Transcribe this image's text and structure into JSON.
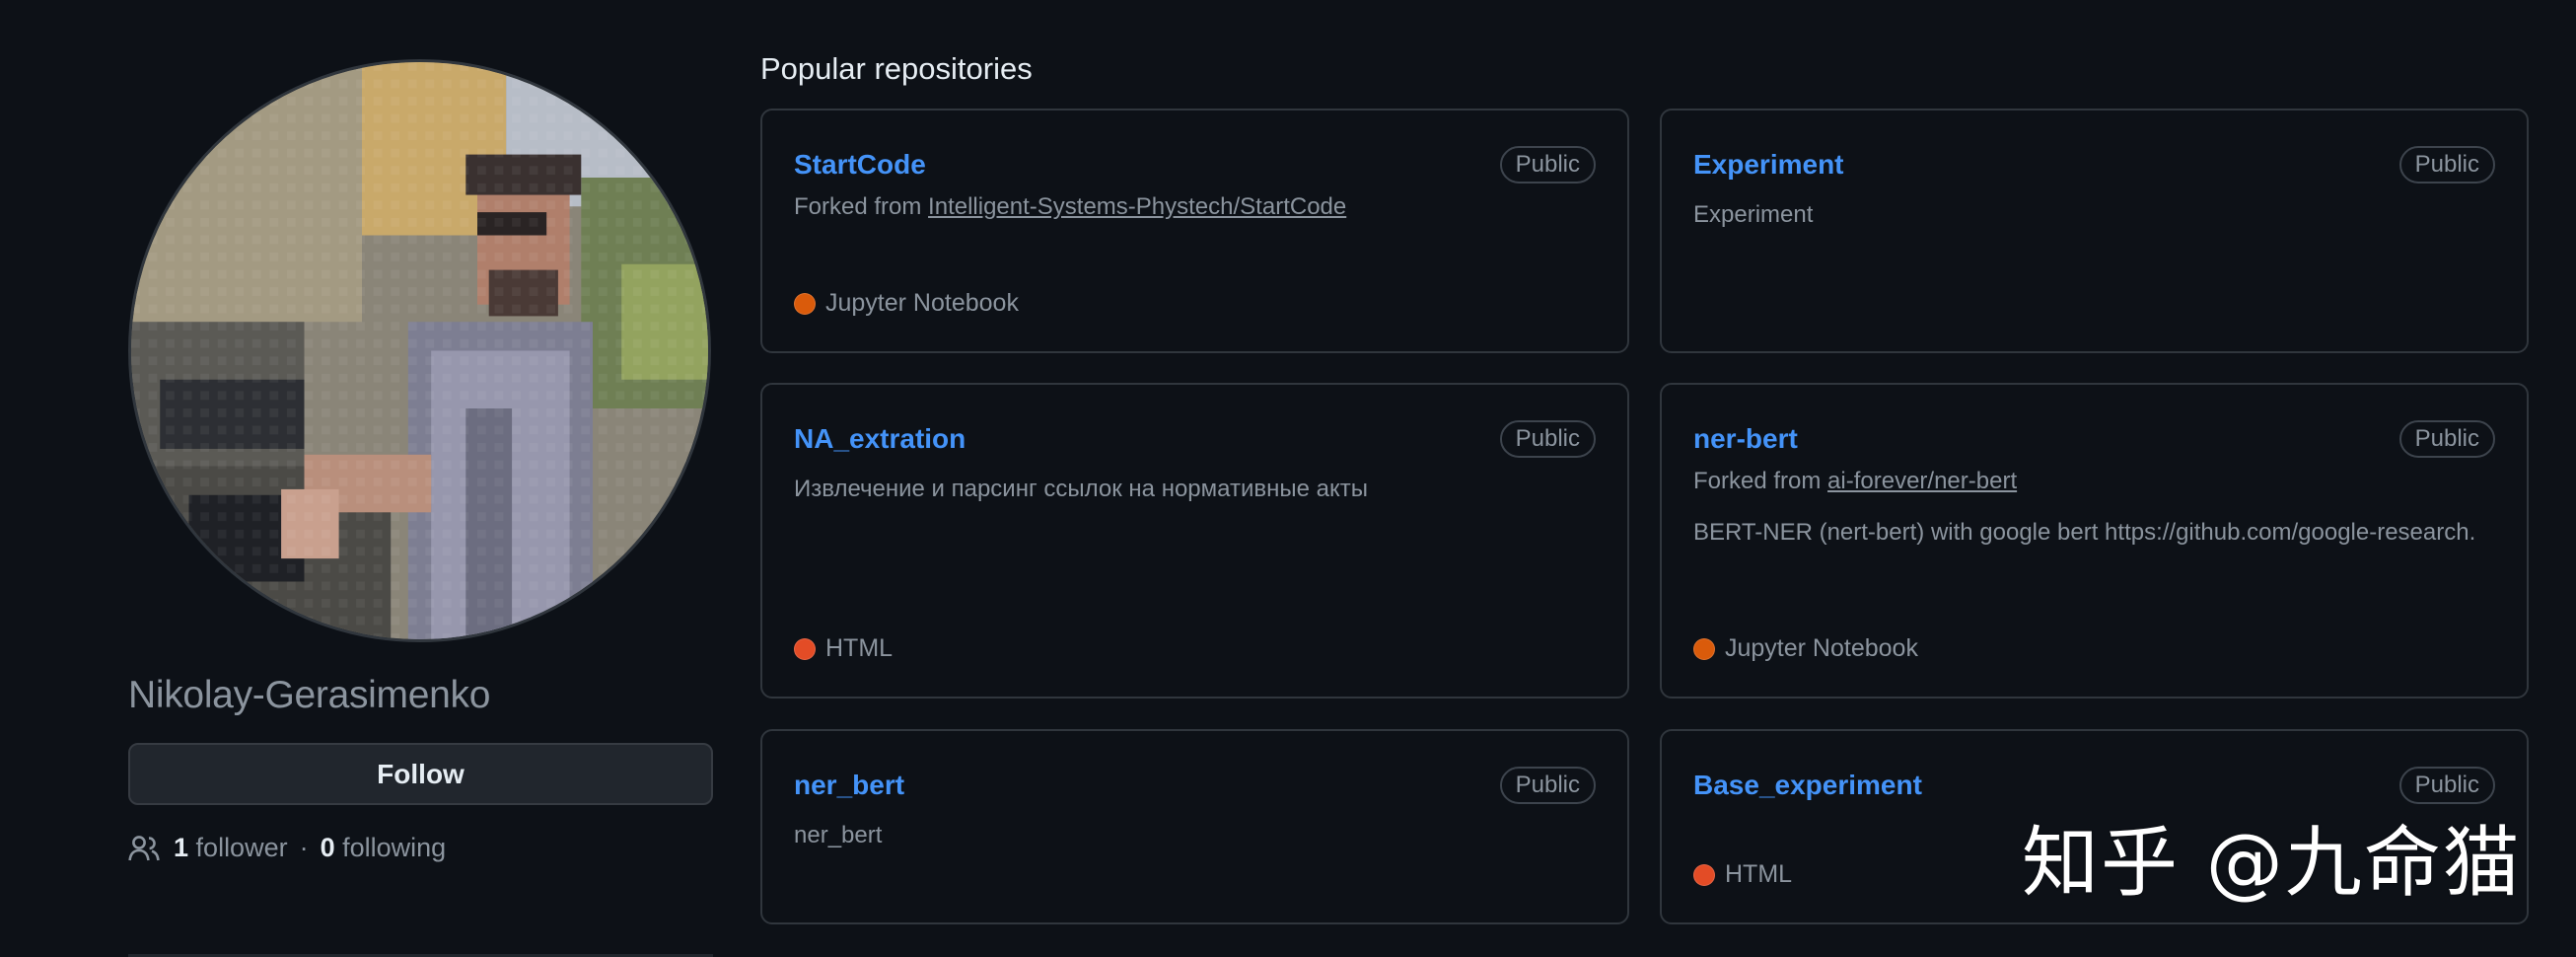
{
  "profile": {
    "username": "Nikolay-Gerasimenko",
    "follow_label": "Follow",
    "followers_count": "1",
    "followers_label": "follower",
    "separator": "·",
    "following_count": "0",
    "following_label": "following",
    "people_icon": "people-icon"
  },
  "popular": {
    "title": "Popular repositories",
    "repos": [
      {
        "name": "StartCode",
        "visibility": "Public",
        "forked_prefix": "Forked from",
        "forked_from": "Intelligent-Systems-Phystech/StartCode",
        "description": "",
        "language": "Jupyter Notebook",
        "language_color": "#DA5B0B"
      },
      {
        "name": "Experiment",
        "visibility": "Public",
        "forked_prefix": "",
        "forked_from": "",
        "description": "Experiment",
        "language": "",
        "language_color": ""
      },
      {
        "name": "NA_extration",
        "visibility": "Public",
        "forked_prefix": "",
        "forked_from": "",
        "description": "Извлечение и парсинг ссылок на нормативные акты",
        "language": "HTML",
        "language_color": "#e34c26"
      },
      {
        "name": "ner-bert",
        "visibility": "Public",
        "forked_prefix": "Forked from",
        "forked_from": "ai-forever/ner-bert",
        "description": "BERT-NER (nert-bert) with google bert https://github.com/google-research.",
        "language": "Jupyter Notebook",
        "language_color": "#DA5B0B"
      },
      {
        "name": "ner_bert",
        "visibility": "Public",
        "forked_prefix": "",
        "forked_from": "",
        "description": "ner_bert",
        "language": "",
        "language_color": ""
      },
      {
        "name": "Base_experiment",
        "visibility": "Public",
        "forked_prefix": "",
        "forked_from": "",
        "description": "",
        "language": "HTML",
        "language_color": "#e34c26"
      }
    ]
  },
  "watermark": {
    "text": "知乎 @九命猫"
  },
  "colors": {
    "background": "#0d1117",
    "link": "#4493f8",
    "muted": "#8b949e",
    "border": "#30363d"
  }
}
